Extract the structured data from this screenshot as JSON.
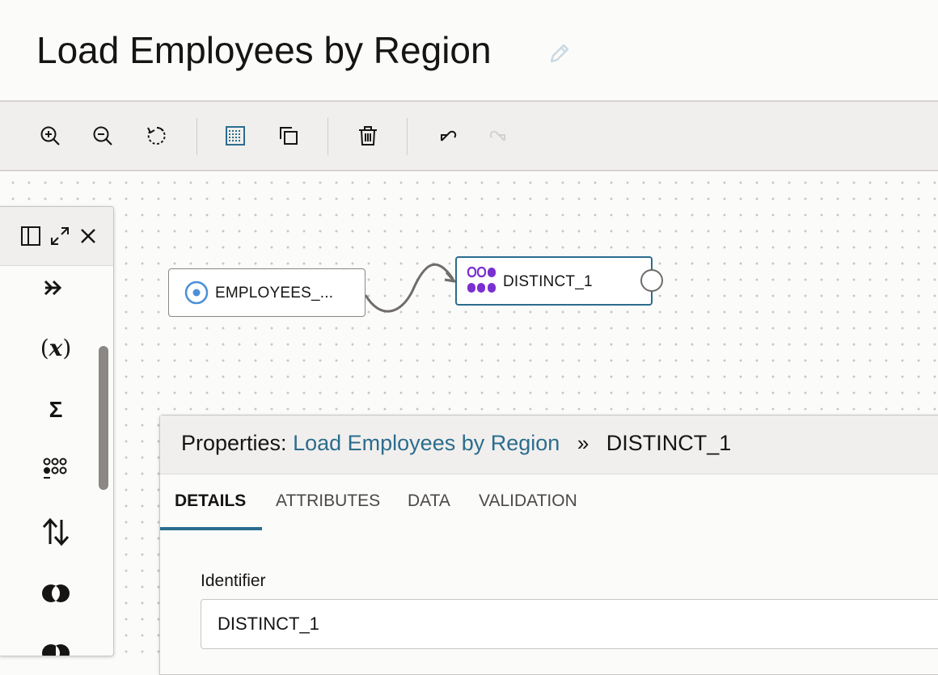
{
  "page": {
    "title": "Load Employees by Region"
  },
  "toolbar": {
    "buttons": [
      "zoom-in-icon",
      "zoom-out-icon",
      "reset-icon",
      "grid-icon",
      "copy-icon",
      "delete-icon",
      "undo-icon",
      "redo-icon"
    ]
  },
  "palette": {
    "header_icons": [
      "panel-icon",
      "expand-icon",
      "close-icon"
    ],
    "items": [
      {
        "icon": "chevrons-right-icon",
        "glyph": "»"
      },
      {
        "icon": "expression-icon",
        "glyph": "(x)"
      },
      {
        "icon": "sigma-icon",
        "glyph": "Σ"
      },
      {
        "icon": "distinct-icon",
        "glyph": ""
      },
      {
        "icon": "sort-icon",
        "glyph": "⇅"
      },
      {
        "icon": "join-icon",
        "glyph": ""
      }
    ]
  },
  "canvas": {
    "source_node": {
      "label": "EMPLOYEES_..."
    },
    "target_node": {
      "label": "DISTINCT_1"
    }
  },
  "properties": {
    "prefix": "Properties:",
    "link": "Load Employees by Region",
    "separator": "»",
    "current": "DISTINCT_1",
    "tabs": [
      "DETAILS",
      "ATTRIBUTES",
      "DATA",
      "VALIDATION"
    ],
    "active_tab": "DETAILS",
    "identifier_label": "Identifier",
    "identifier_value": "DISTINCT_1"
  },
  "colors": {
    "accent": "#2b6d8e",
    "purple": "#7b2fd0",
    "node_source_icon": "#4a90d9"
  }
}
